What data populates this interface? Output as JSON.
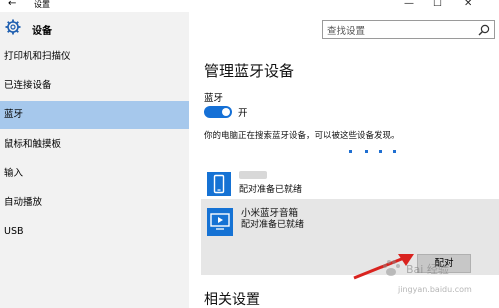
{
  "window": {
    "back_glyph": "←",
    "title": "设置",
    "min_glyph": "—",
    "max_glyph": "☐",
    "close_glyph": "✕"
  },
  "sidebar": {
    "header_icon": "gear-icon",
    "title": "设备",
    "items": [
      {
        "label": "打印机和扫描仪",
        "selected": false
      },
      {
        "label": "已连接设备",
        "selected": false
      },
      {
        "label": "蓝牙",
        "selected": true
      },
      {
        "label": "鼠标和触摸板",
        "selected": false
      },
      {
        "label": "输入",
        "selected": false
      },
      {
        "label": "自动播放",
        "selected": false
      },
      {
        "label": "USB",
        "selected": false
      }
    ]
  },
  "search": {
    "placeholder": "查找设置",
    "icon": "search-icon"
  },
  "main": {
    "title": "管理蓝牙设备",
    "bluetooth_label": "蓝牙",
    "toggle_state": "开",
    "toggle_on": true,
    "discover_text": "你的电脑正在搜索蓝牙设备，可以被这些设备发现。",
    "devices": [
      {
        "name": "",
        "status": "配对准备已就绪",
        "icon": "phone-icon"
      },
      {
        "name": "小米蓝牙音箱",
        "status": "配对准备已就绪",
        "icon": "display-icon"
      }
    ],
    "pair_button": "配对",
    "related_title": "相关设置"
  },
  "watermark": {
    "line1": "Bai 经验",
    "line2": "jingyan.baidu.com"
  },
  "colors": {
    "accent": "#1570d6",
    "selected_item": "#a6c8ec",
    "sidebar_bg": "#f2f2f2",
    "device_selected_bg": "#e6e6e6",
    "arrow": "#d9231f"
  }
}
